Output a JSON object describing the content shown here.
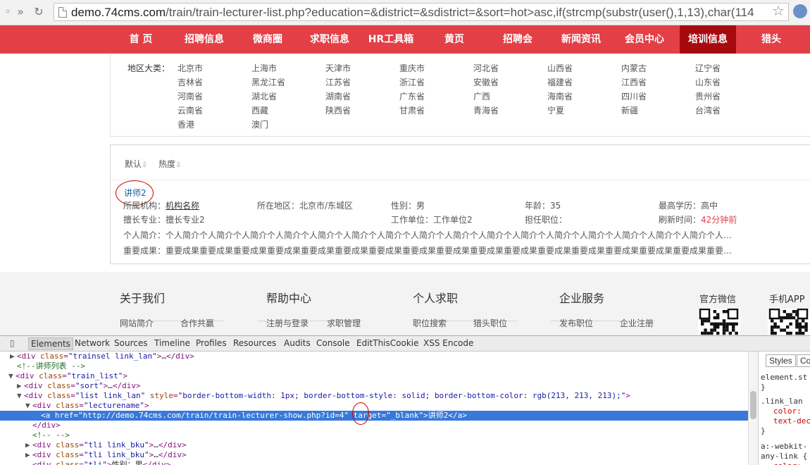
{
  "browser": {
    "url_host": "demo.74cms.com",
    "url_path": "/train/train-lecturer-list.php?education=&district=&sdistrict=&sort=hot>asc,if(strcmp(substr(user(),1,13),char(114"
  },
  "nav": {
    "items": [
      "首 页",
      "招聘信息",
      "微商圈",
      "求职信息",
      "HR工具箱",
      "黄页",
      "招聘会",
      "新闻资讯",
      "会员中心",
      "培训信息",
      "猎头"
    ],
    "active_index": 9,
    "bg_color": "#e33f46",
    "active_color": "#a60a0f"
  },
  "region": {
    "label": "地区大类：",
    "rows": [
      [
        "北京市",
        "上海市",
        "天津市",
        "重庆市",
        "河北省",
        "山西省",
        "内蒙古",
        "辽宁省"
      ],
      [
        "吉林省",
        "黑龙江省",
        "江苏省",
        "浙江省",
        "安徽省",
        "福建省",
        "江西省",
        "山东省"
      ],
      [
        "河南省",
        "湖北省",
        "湖南省",
        "广东省",
        "广西",
        "海南省",
        "四川省",
        "贵州省"
      ],
      [
        "云南省",
        "西藏",
        "陕西省",
        "甘肃省",
        "青海省",
        "宁夏",
        "新疆",
        "台湾省"
      ],
      [
        "香港",
        "澳门"
      ]
    ]
  },
  "sort": {
    "default_label": "默认",
    "hot_label": "热度"
  },
  "lecturer": {
    "name": "讲师2",
    "org_label": "所属机构：",
    "org_value": "机构名称",
    "area": "所在地区：北京市/东城区",
    "gender": "性别：男",
    "age": "年龄：35",
    "education": "最高学历：高中",
    "specialty": "擅长专业：擅长专业2",
    "workplace": "工作单位：工作单位2",
    "position": "担任职位：",
    "refresh_label": "刷新时间：",
    "refresh_value": "42分钟前",
    "intro": "个人简介：个人简介个人简介个人简介个人简介个人简介个人简介个人简介个人简介个人简介个人简介个人简介个人简介个人简介个人简介个人简介个人简介个人简介个人简介…",
    "achievement": "重要成果：重要成果重要成果重要成果重要成果重要成果重要成果重要成果重要成果重要成果重要成果重要成果重要成果重要成果重要成果重要成果重要成果重要成果重要成果重要成…"
  },
  "footer": {
    "about": {
      "title": "关于我们",
      "links": [
        "网站简介",
        "合作共赢"
      ]
    },
    "help": {
      "title": "帮助中心",
      "links": [
        "注册与登录",
        "求职管理"
      ]
    },
    "jobseek": {
      "title": "个人求职",
      "links": [
        "职位搜索",
        "猎头职位"
      ]
    },
    "enterprise": {
      "title": "企业服务",
      "links": [
        "发布职位",
        "企业注册"
      ]
    },
    "wechat_title": "官方微信",
    "app_title": "手机APP"
  },
  "devtools": {
    "tabs": [
      "Elements",
      "Network",
      "Sources",
      "Timeline",
      "Profiles",
      "Resources",
      "Audits",
      "Console",
      "EditThisCookie",
      "XSS Encode"
    ],
    "selected_tab": "Elements",
    "styles_tab": "Styles",
    "styles_tab2": "Co",
    "styles_lines": [
      "element.st",
      "}",
      ".link_lan",
      "color: ",
      "text-dec",
      "}",
      "a:-webkit-",
      "any-link {",
      "color:"
    ]
  }
}
